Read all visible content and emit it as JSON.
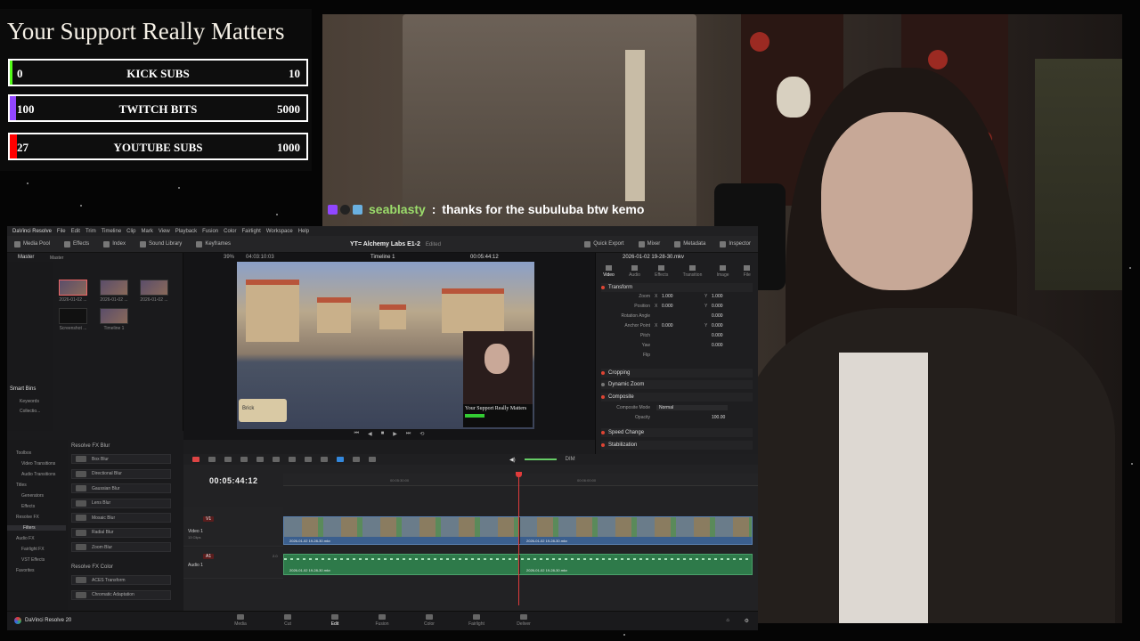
{
  "support": {
    "title": "Your Support Really Matters",
    "goals": [
      {
        "name": "KICK SUBS",
        "current": "0",
        "target": "10",
        "progress": 0.0,
        "color": "#53fc18"
      },
      {
        "name": "TWITCH BITS",
        "current": "100",
        "target": "5000",
        "progress": 0.02,
        "color": "#9146ff"
      },
      {
        "name": "YOUTUBE SUBS",
        "current": "27",
        "target": "1000",
        "progress": 0.027,
        "color": "#ff0000"
      }
    ]
  },
  "chat": {
    "user": "seablasty",
    "separator": " : ",
    "message": "thanks for the subuluba btw kemo"
  },
  "resolve": {
    "menu": [
      "DaVinci Resolve",
      "File",
      "Edit",
      "Trim",
      "Timeline",
      "Clip",
      "Mark",
      "View",
      "Playback",
      "Fusion",
      "Color",
      "Fairlight",
      "Workspace",
      "Help"
    ],
    "toolbar_left": [
      "Media Pool",
      "Effects",
      "Index",
      "Sound Library",
      "Keyframes"
    ],
    "project": "YT= Alchemy Labs E1-2",
    "project_status": "Edited",
    "toolbar_right": [
      "Quick Export",
      "Mixer",
      "Metadata",
      "Inspector"
    ],
    "pool_tabs": [
      "Master",
      "Master"
    ],
    "pool_items": [
      "2026-01-02 ...",
      "2026-01-02 ...",
      "2026-01-02 ...",
      "Screenshot ...",
      "Timeline 1"
    ],
    "smart_bins": "Smart Bins",
    "smart_items": [
      "Keywords",
      "Collectio..."
    ],
    "viewer": {
      "zoom": "39%",
      "timecode": "04:03:10:03",
      "timeline": "Timeline 1",
      "right_tc": "00:05:44:12",
      "hud": "Brick",
      "caption": "Your Support Really Matters"
    },
    "inspector": {
      "clip": "2026-01-02 19-28-30.mkv",
      "tabs": [
        "Video",
        "Audio",
        "Effects",
        "Transition",
        "Image",
        "File"
      ],
      "transform": "Transform",
      "props": [
        {
          "label": "Zoom",
          "x": "1.000",
          "y": "1.000"
        },
        {
          "label": "Position",
          "x": "0.000",
          "y": "0.000"
        },
        {
          "label": "Rotation Angle",
          "x": "",
          "y": "0.000"
        },
        {
          "label": "Anchor Point",
          "x": "0.000",
          "y": "0.000"
        },
        {
          "label": "Pitch",
          "x": "",
          "y": "0.000"
        },
        {
          "label": "Yaw",
          "x": "",
          "y": "0.000"
        },
        {
          "label": "Flip",
          "x": "",
          "y": ""
        }
      ],
      "sections": [
        "Cropping",
        "Dynamic Zoom",
        "Composite"
      ],
      "composite_mode_label": "Composite Mode",
      "composite_mode": "Normal",
      "opacity_label": "Opacity",
      "opacity": "100.00",
      "more_sections": [
        "Speed Change",
        "Stabilization"
      ]
    },
    "fx_tree": [
      "Toolbox",
      "Video Transitions",
      "Audio Transitions",
      "Titles",
      "Generators",
      "Effects",
      "Resolve FX",
      "Filters",
      "Audio FX",
      "Fairlight FX",
      "VST Effects",
      "Favorites"
    ],
    "fx_header": "Resolve FX Blur",
    "fx_items": [
      "Box Blur",
      "Directional Blur",
      "Gaussian Blur",
      "Lens Blur",
      "Mosaic Blur",
      "Radial Blur",
      "Zoom Blur"
    ],
    "fx_header2": "Resolve FX Color",
    "fx_items2": [
      "ACES Transform",
      "Chromatic Adaptation"
    ],
    "timecode": "00:05:44:12",
    "ruler": [
      "00:05:30:00",
      "00:06:00:00"
    ],
    "video_track": {
      "tag": "V1",
      "name": "Video 1",
      "sub": "13 Clips"
    },
    "audio_track": {
      "tag": "A1",
      "name": "Audio 1",
      "sub": "2.0"
    },
    "clip_name": "2026-01-02 19-28-30.mkv",
    "volume": "DIM",
    "brand": "DaVinci Resolve 20",
    "pages": [
      "Media",
      "Cut",
      "Edit",
      "Fusion",
      "Color",
      "Fairlight",
      "Deliver"
    ],
    "active_page": "Edit"
  }
}
